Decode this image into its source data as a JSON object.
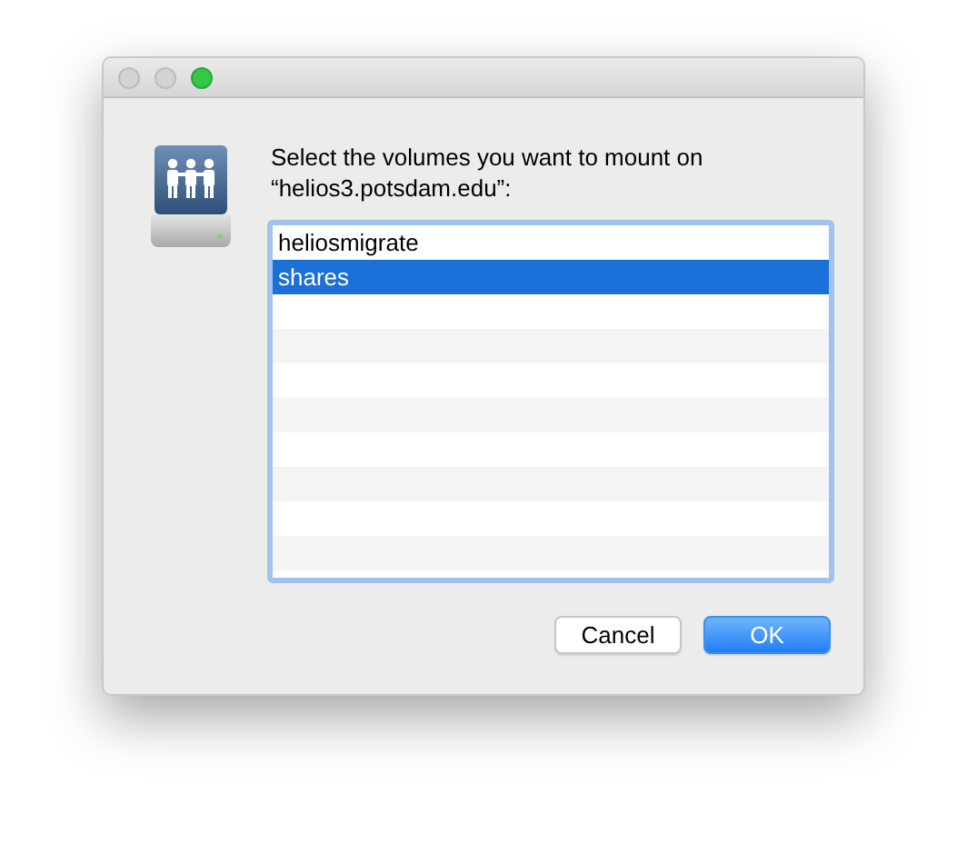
{
  "dialog": {
    "message": "Select the volumes you want to mount on “helios3.potsdam.edu”:"
  },
  "volumes": [
    {
      "name": "heliosmigrate",
      "selected": false
    },
    {
      "name": "shares",
      "selected": true
    }
  ],
  "buttons": [
    {
      "label": "Cancel",
      "kind": "normal"
    },
    {
      "label": "OK",
      "kind": "default"
    }
  ]
}
